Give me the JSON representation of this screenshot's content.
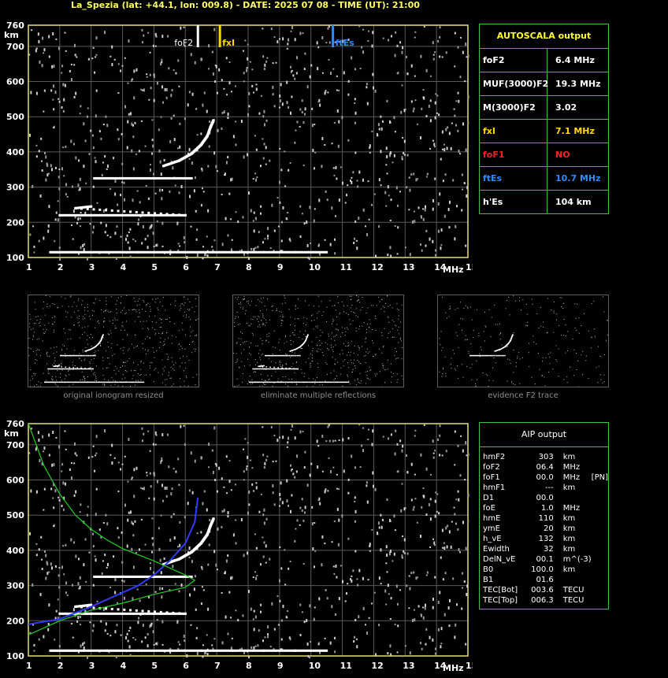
{
  "header": {
    "title": "La_Spezia (lat: +44.1, lon: 009.8) - DATE: 2025 07 08 - TIME (UT): 21:00"
  },
  "ionogram": {
    "unit_y": "km",
    "unit_x": "MHz",
    "y_ticks": [
      100,
      200,
      300,
      400,
      500,
      600,
      700,
      760
    ],
    "x_ticks": [
      1,
      2,
      3,
      4,
      5,
      6,
      7,
      8,
      9,
      10,
      11,
      12,
      13,
      14,
      15
    ],
    "markers": [
      {
        "label": "foF2",
        "freq": 6.4,
        "color": "#ffffff"
      },
      {
        "label": "fxI",
        "freq": 7.1,
        "color": "#ffd800"
      },
      {
        "label": "ftEs",
        "freq": 10.7,
        "color": "#2f8cff"
      }
    ]
  },
  "autoscala": {
    "title": "AUTOSCALA output",
    "rows": [
      {
        "key": "foF2",
        "value": "6.4 MHz",
        "key_color": "#ffffff",
        "val_color": "#ffffff"
      },
      {
        "key": "MUF(3000)F2",
        "value": "19.3 MHz",
        "key_color": "#ffffff",
        "val_color": "#ffffff"
      },
      {
        "key": "M(3000)F2",
        "value": "3.02",
        "key_color": "#ffffff",
        "val_color": "#ffffff"
      },
      {
        "key": "fxI",
        "value": "7.1 MHz",
        "key_color": "#ffd800",
        "val_color": "#ffd800"
      },
      {
        "key": "foF1",
        "value": "NO",
        "key_color": "#ff2020",
        "val_color": "#ff2020"
      },
      {
        "key": "ftEs",
        "value": "10.7 MHz",
        "key_color": "#2f8cff",
        "val_color": "#2f8cff"
      },
      {
        "key": "h'Es",
        "value": "104    km",
        "key_color": "#ffffff",
        "val_color": "#ffffff"
      }
    ]
  },
  "thumbnails": [
    {
      "caption": "original ionogram resized"
    },
    {
      "caption": "eliminate multiple reflections"
    },
    {
      "caption": "evidence F2 trace"
    }
  ],
  "aip": {
    "title": "AIP output",
    "rows": [
      [
        "hmF2",
        "303",
        "km",
        ""
      ],
      [
        "foF2",
        "06.4",
        "MHz",
        ""
      ],
      [
        "foF1",
        "00.0",
        "MHz",
        "[PN]"
      ],
      [
        "hmF1",
        "---",
        "km",
        ""
      ],
      [
        "D1",
        "00.0",
        "",
        ""
      ],
      [
        "foE",
        "1.0",
        "MHz",
        ""
      ],
      [
        "hmE",
        "110",
        "km",
        ""
      ],
      [
        "ymE",
        "20",
        "km",
        ""
      ],
      [
        "h_vE",
        "132",
        "km",
        ""
      ],
      [
        "Ewidth",
        "32",
        "km",
        ""
      ],
      [
        "DelN_vE",
        "00.1",
        "m^(-3)",
        ""
      ],
      [
        "B0",
        "100.0",
        "km",
        ""
      ],
      [
        "B1",
        "01.6",
        "",
        ""
      ],
      [
        "TEC[Bot]",
        "003.6",
        "TECU",
        ""
      ],
      [
        "TEC[Top]",
        "006.3",
        "TECU",
        ""
      ]
    ]
  },
  "chart_data": [
    {
      "type": "scatter",
      "title": "",
      "xlabel": "MHz",
      "ylabel": "km",
      "xlim": [
        1,
        15
      ],
      "ylim": [
        100,
        760
      ],
      "grid": true,
      "series": [
        {
          "name": "",
          "points": [
            [
              1.7,
              115
            ],
            [
              2.5,
              115
            ],
            [
              3.5,
              115
            ],
            [
              4.5,
              115
            ],
            [
              5.5,
              115
            ],
            [
              6.5,
              115
            ],
            [
              7.5,
              115
            ],
            [
              8.5,
              115
            ],
            [
              9.5,
              115
            ],
            [
              10.5,
              115
            ]
          ]
        },
        {
          "name": "",
          "points": [
            [
              2.0,
              220
            ],
            [
              3.0,
              220
            ],
            [
              4.0,
              220
            ],
            [
              5.0,
              220
            ],
            [
              6.0,
              220
            ],
            [
              2.5,
              240
            ],
            [
              3.0,
              245
            ]
          ]
        },
        {
          "name": "",
          "points": [
            [
              3.1,
              325
            ],
            [
              4.0,
              325
            ],
            [
              5.0,
              325
            ],
            [
              6.2,
              325
            ]
          ]
        },
        {
          "name": "",
          "points": [
            [
              5.3,
              360
            ],
            [
              5.8,
              375
            ],
            [
              6.2,
              395
            ],
            [
              6.5,
              420
            ],
            [
              6.7,
              445
            ],
            [
              6.8,
              470
            ],
            [
              6.9,
              490
            ]
          ]
        }
      ]
    },
    {
      "type": "line",
      "title": "",
      "xlabel": "MHz",
      "ylabel": "km",
      "xlim": [
        1,
        15
      ],
      "ylim": [
        100,
        760
      ],
      "grid": true,
      "series": [
        {
          "name": "",
          "points": [
            [
              1.0,
              190
            ],
            [
              2.0,
              205
            ],
            [
              3.0,
              240
            ],
            [
              4.0,
              280
            ],
            [
              4.5,
              300
            ],
            [
              5.0,
              330
            ],
            [
              5.5,
              370
            ],
            [
              6.0,
              420
            ],
            [
              6.3,
              480
            ],
            [
              6.4,
              550
            ]
          ]
        },
        {
          "name": "",
          "points": [
            [
              1.0,
              760
            ],
            [
              1.5,
              640
            ],
            [
              2.0,
              560
            ],
            [
              2.5,
              500
            ],
            [
              3.0,
              460
            ],
            [
              3.5,
              430
            ],
            [
              4.0,
              405
            ],
            [
              5.0,
              370
            ],
            [
              6.0,
              330
            ],
            [
              6.3,
              315
            ],
            [
              6.0,
              295
            ],
            [
              5.0,
              275
            ],
            [
              4.0,
              250
            ],
            [
              3.0,
              230
            ],
            [
              2.0,
              200
            ],
            [
              1.0,
              160
            ]
          ]
        }
      ]
    }
  ]
}
